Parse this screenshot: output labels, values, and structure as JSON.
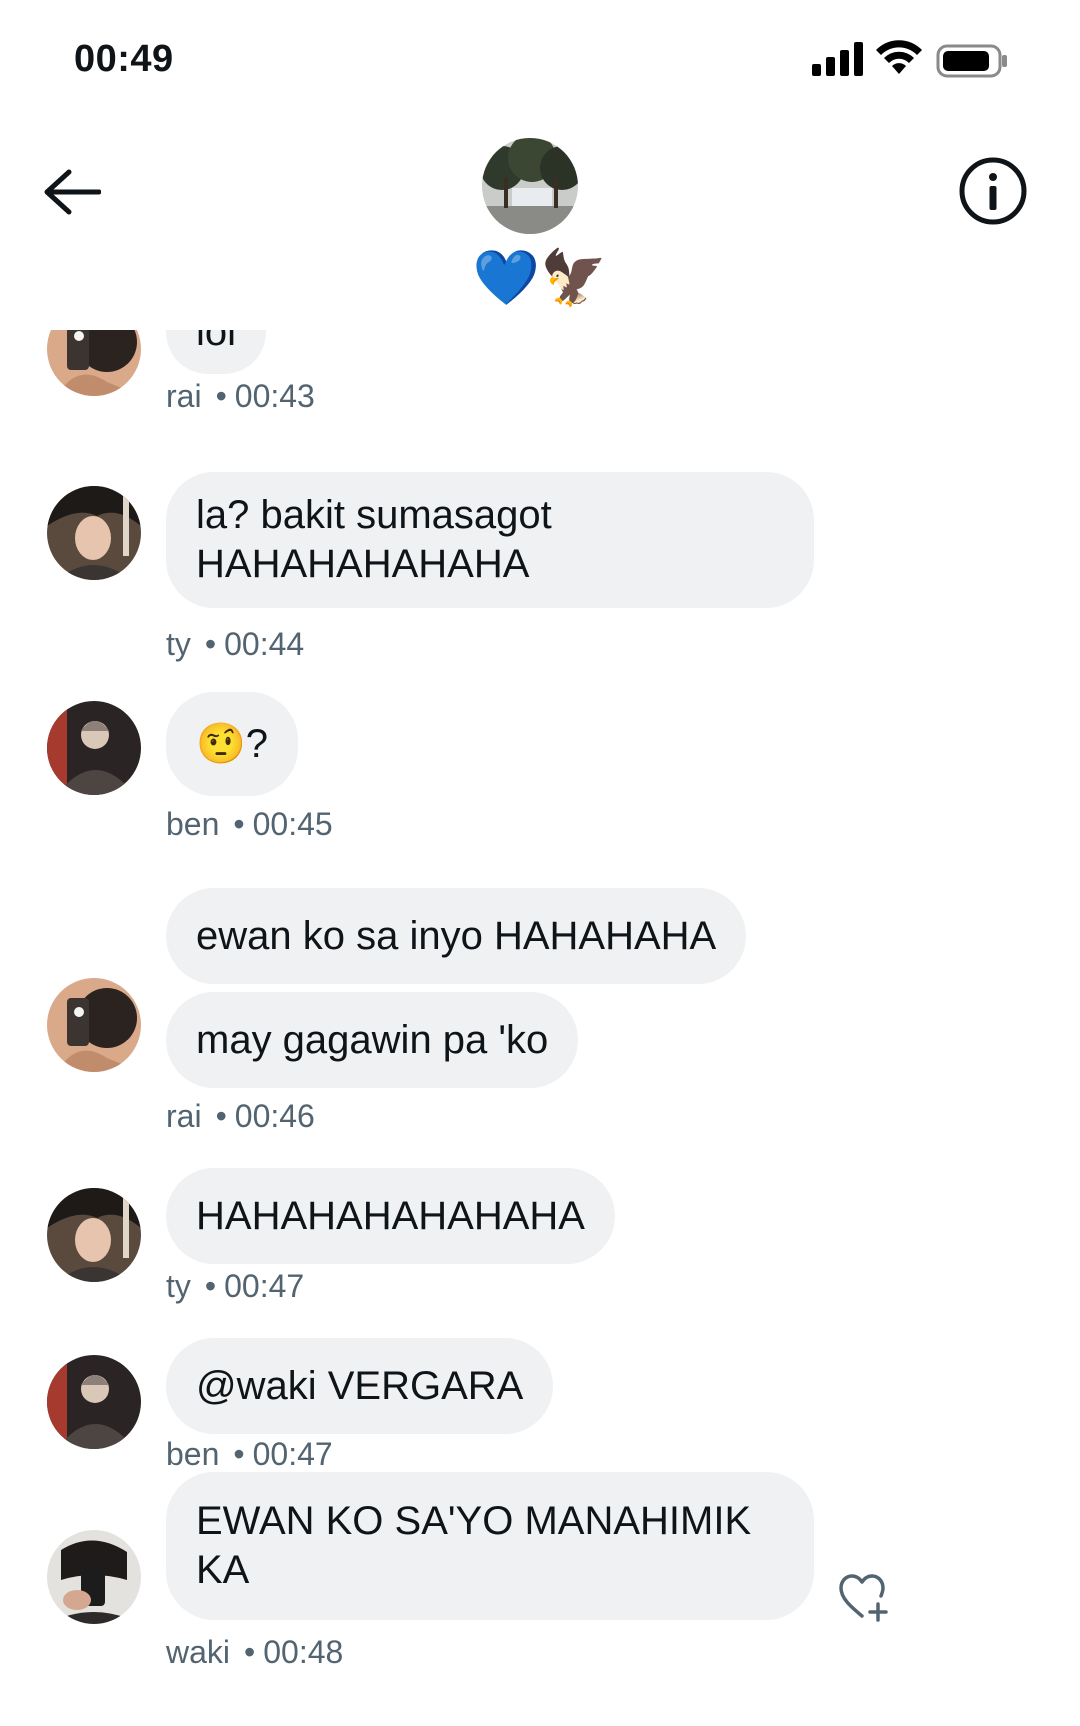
{
  "status_bar": {
    "time": "00:49"
  },
  "header": {
    "group_name": "💙🦅"
  },
  "messages": [
    {
      "text_lines": [
        "lol"
      ],
      "sender": "rai",
      "time": "00:43"
    },
    {
      "text_lines": [
        "la? bakit sumasagot",
        "HAHAHAHAHAHA"
      ],
      "sender": "ty",
      "time": "00:44"
    },
    {
      "text_lines": [
        "🤨?"
      ],
      "sender": "ben",
      "time": "00:45"
    },
    {
      "text_lines": [
        "ewan ko sa inyo HAHAHAHA"
      ]
    },
    {
      "text_lines": [
        "may gagawin pa 'ko"
      ],
      "sender": "rai",
      "time": "00:46"
    },
    {
      "text_lines": [
        "HAHAHAHAHAHAHA"
      ],
      "sender": "ty",
      "time": "00:47"
    },
    {
      "text_lines": [
        "@waki VERGARA"
      ],
      "sender": "ben",
      "time": "00:47"
    },
    {
      "text_lines": [
        "EWAN KO SA'YO MANAHIMIK",
        "KA"
      ],
      "sender": "waki",
      "time": "00:48"
    }
  ],
  "meta_separator": "•",
  "icons": {
    "back": "back-arrow-icon",
    "info": "info-icon",
    "react": "heart-add-icon"
  },
  "colors": {
    "bubble": "#eff1f3",
    "meta_text": "#536471",
    "text": "#0f1419"
  }
}
